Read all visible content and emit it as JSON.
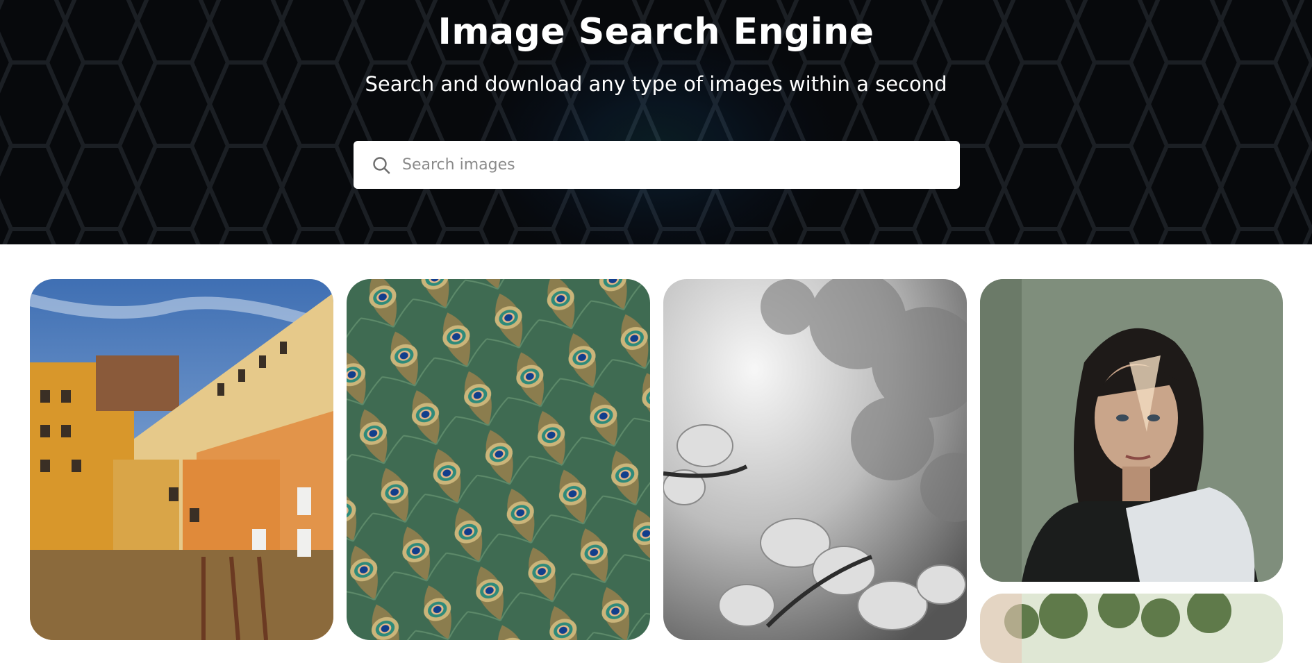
{
  "hero": {
    "title": "Image Search Engine",
    "subtitle": "Search and download any type of images within a second",
    "accent_color": "#1e88e5"
  },
  "search": {
    "placeholder": "Search images",
    "value": "",
    "icon": "search-icon"
  },
  "gallery": {
    "images": [
      {
        "subject": "colorful-buildings-by-river"
      },
      {
        "subject": "peacock-feathers"
      },
      {
        "subject": "black-and-white-magnolia-blossoms"
      },
      {
        "subject": "woman-portrait-in-window-light"
      },
      {
        "subject": "tree-foliage-partially-visible"
      }
    ]
  }
}
